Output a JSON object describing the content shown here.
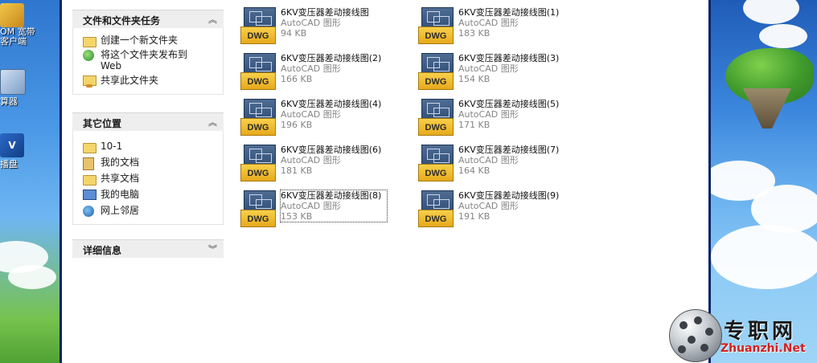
{
  "desktop_left": {
    "icons": [
      {
        "label": "OM 宽带\n客户端",
        "icon": "broadband-client-icon"
      },
      {
        "label": "算器",
        "icon": "calculator-icon"
      },
      {
        "label": "播盘",
        "icon": "media-icon"
      }
    ]
  },
  "task_pane": {
    "file_tasks": {
      "title": "文件和文件夹任务",
      "toggle": "︽",
      "items": [
        {
          "label": "创建一个新文件夹",
          "icon": "new-folder-icon"
        },
        {
          "label": "将这个文件夹发布到\nWeb",
          "icon": "publish-web-icon"
        },
        {
          "label": "共享此文件夹",
          "icon": "share-folder-icon"
        }
      ]
    },
    "other_places": {
      "title": "其它位置",
      "toggle": "︽",
      "items": [
        {
          "label": "10-1",
          "icon": "folder-icon"
        },
        {
          "label": "我的文档",
          "icon": "my-documents-icon"
        },
        {
          "label": "共享文档",
          "icon": "shared-documents-icon"
        },
        {
          "label": "我的电脑",
          "icon": "my-computer-icon"
        },
        {
          "label": "网上邻居",
          "icon": "network-places-icon"
        }
      ]
    },
    "details": {
      "title": "详细信息",
      "toggle": "︾"
    }
  },
  "files": [
    {
      "name": "6KV变压器差动接线图",
      "type": "AutoCAD 图形",
      "size": "94 KB",
      "icon_text": "DWG"
    },
    {
      "name": "6KV变压器差动接线图(1)",
      "type": "AutoCAD 图形",
      "size": "183 KB",
      "icon_text": "DWG"
    },
    {
      "name": "6KV变压器差动接线图(2)",
      "type": "AutoCAD 图形",
      "size": "166 KB",
      "icon_text": "DWG"
    },
    {
      "name": "6KV变压器差动接线图(3)",
      "type": "AutoCAD 图形",
      "size": "154 KB",
      "icon_text": "DWG"
    },
    {
      "name": "6KV变压器差动接线图(4)",
      "type": "AutoCAD 图形",
      "size": "196 KB",
      "icon_text": "DWG"
    },
    {
      "name": "6KV变压器差动接线图(5)",
      "type": "AutoCAD 图形",
      "size": "171 KB",
      "icon_text": "DWG"
    },
    {
      "name": "6KV变压器差动接线图(6)",
      "type": "AutoCAD 图形",
      "size": "181 KB",
      "icon_text": "DWG"
    },
    {
      "name": "6KV变压器差动接线图(7)",
      "type": "AutoCAD 图形",
      "size": "164 KB",
      "icon_text": "DWG"
    },
    {
      "name": "6KV变压器差动接线图(8)",
      "type": "AutoCAD 图形",
      "size": "153 KB",
      "icon_text": "DWG",
      "selected": true
    },
    {
      "name": "6KV变压器差动接线图(9)",
      "type": "AutoCAD 图形",
      "size": "191 KB",
      "icon_text": "DWG"
    }
  ],
  "watermark": {
    "cn": "专职网",
    "en": "Zhuanzhi.Net"
  },
  "colors": {
    "accent": "#0a246a",
    "dwg_yellow": "#f8d04a",
    "watermark_red": "#d41f1f"
  }
}
